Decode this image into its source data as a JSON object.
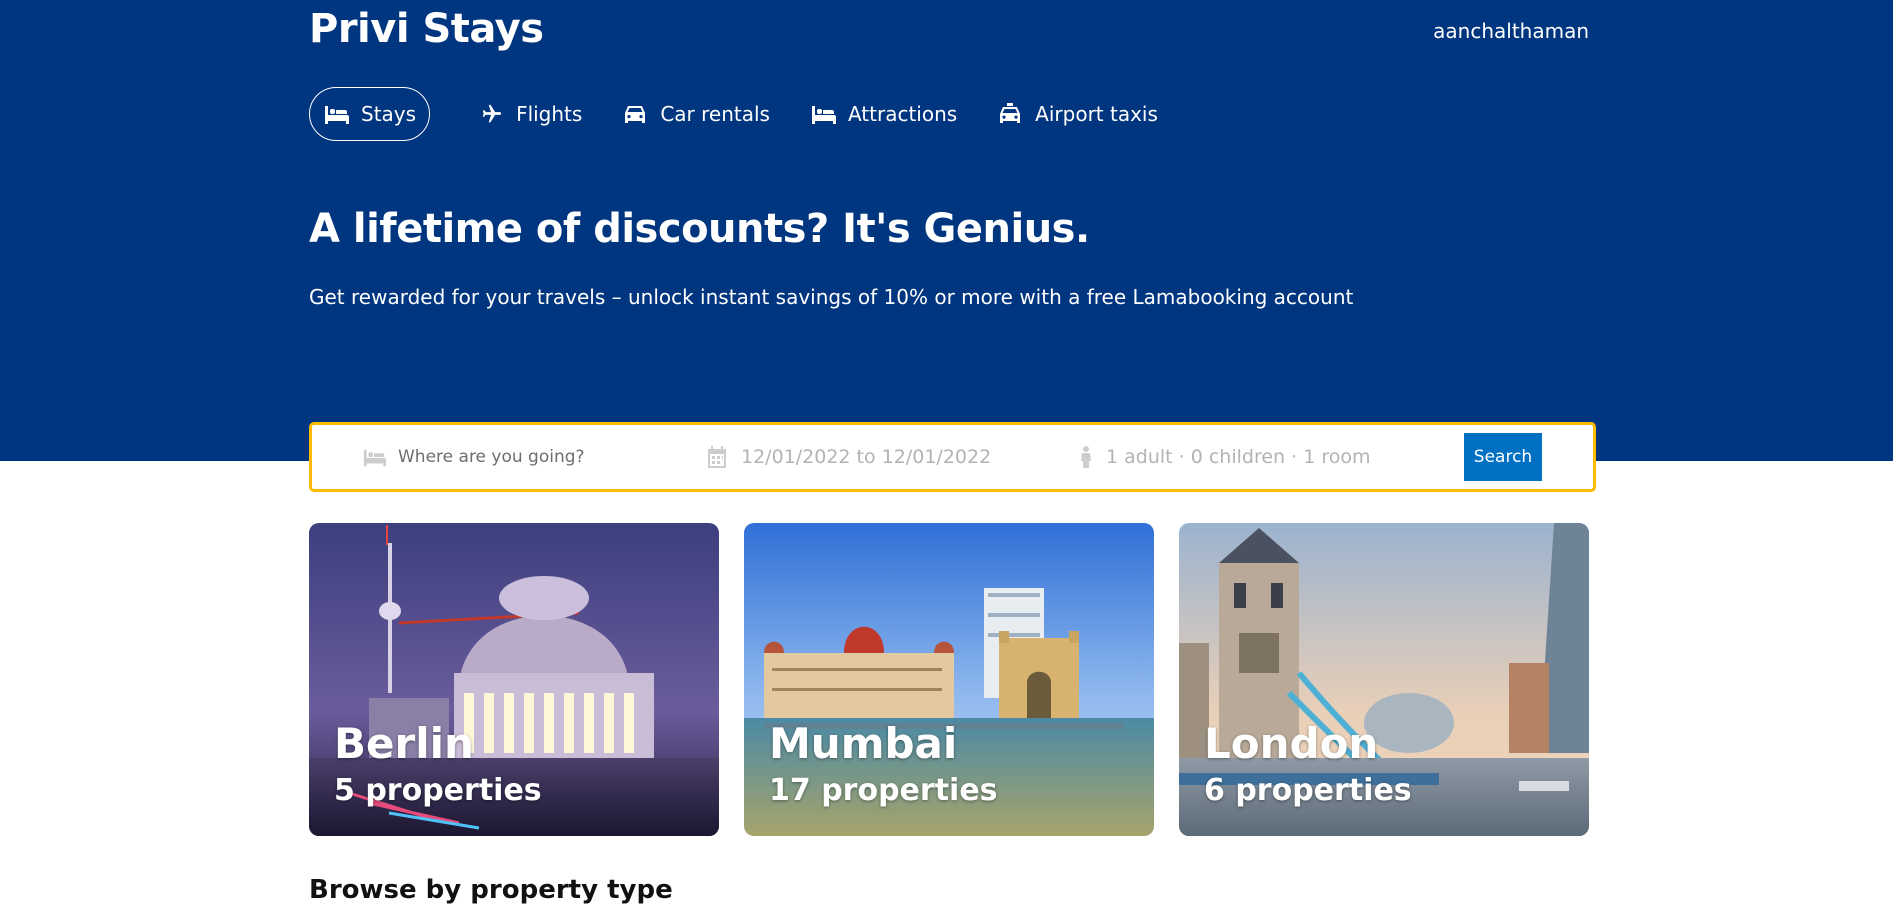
{
  "header": {
    "brand": "Privi Stays",
    "username": "aanchalthaman"
  },
  "nav": {
    "items": [
      {
        "label": "Stays",
        "icon": "bed-icon",
        "active": true
      },
      {
        "label": "Flights",
        "icon": "plane-icon",
        "active": false
      },
      {
        "label": "Car rentals",
        "icon": "car-icon",
        "active": false
      },
      {
        "label": "Attractions",
        "icon": "bed-icon",
        "active": false
      },
      {
        "label": "Airport taxis",
        "icon": "taxi-icon",
        "active": false
      }
    ]
  },
  "hero": {
    "title": "A lifetime of discounts? It's Genius.",
    "subtitle": "Get rewarded for your travels – unlock instant savings of 10% or more with a free Lamabooking account"
  },
  "search": {
    "destination_placeholder": "Where are you going?",
    "dates": "12/01/2022 to 12/01/2022",
    "guests": "1 adult · 0 children · 1 room",
    "button_label": "Search"
  },
  "featured": [
    {
      "city": "Berlin",
      "properties": "5 properties"
    },
    {
      "city": "Mumbai",
      "properties": "17 properties"
    },
    {
      "city": "London",
      "properties": "6 properties"
    }
  ],
  "sections": {
    "browse_title": "Browse by property type"
  },
  "colors": {
    "header_bg": "#003580",
    "search_border": "#febb02",
    "search_button": "#0071c2"
  }
}
